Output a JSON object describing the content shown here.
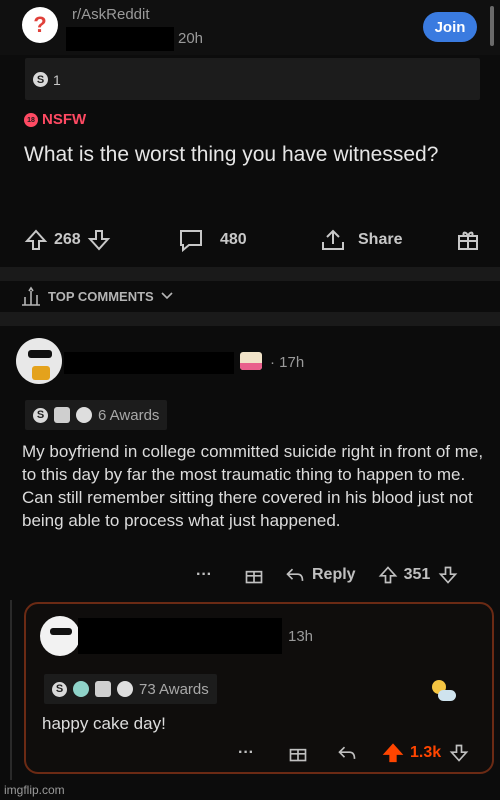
{
  "post": {
    "subreddit": "r/AskReddit",
    "avatar_glyph": "?",
    "time": "20h",
    "join_label": "Join",
    "award_count": "1",
    "award_glyph": "S",
    "nsfw_label": "NSFW",
    "nsfw_badge": "18",
    "title": "What is the worst thing you have witnessed?",
    "upvotes": "268",
    "comments": "480",
    "share_label": "Share"
  },
  "top_comments_label": "TOP COMMENTS",
  "comment": {
    "time": "· 17h",
    "awards_label": "6 Awards",
    "body": "My boyfriend in college committed suicide right in front of me, to this day by far the most traumatic thing to happen to me. Can still remember sitting there covered in his blood just not being able to process what just happened.",
    "more": "···",
    "reply_label": "Reply",
    "score": "351"
  },
  "reply": {
    "time": "13h",
    "awards_label": "73 Awards",
    "body": "happy cake day!",
    "more": "···",
    "score": "1.3k",
    "upvote_color": "#ff4500"
  },
  "watermark": "imgflip.com",
  "colors": {
    "accent": "#3a7be0",
    "nsfw": "#ff4a63",
    "upvoted": "#ff4500"
  }
}
